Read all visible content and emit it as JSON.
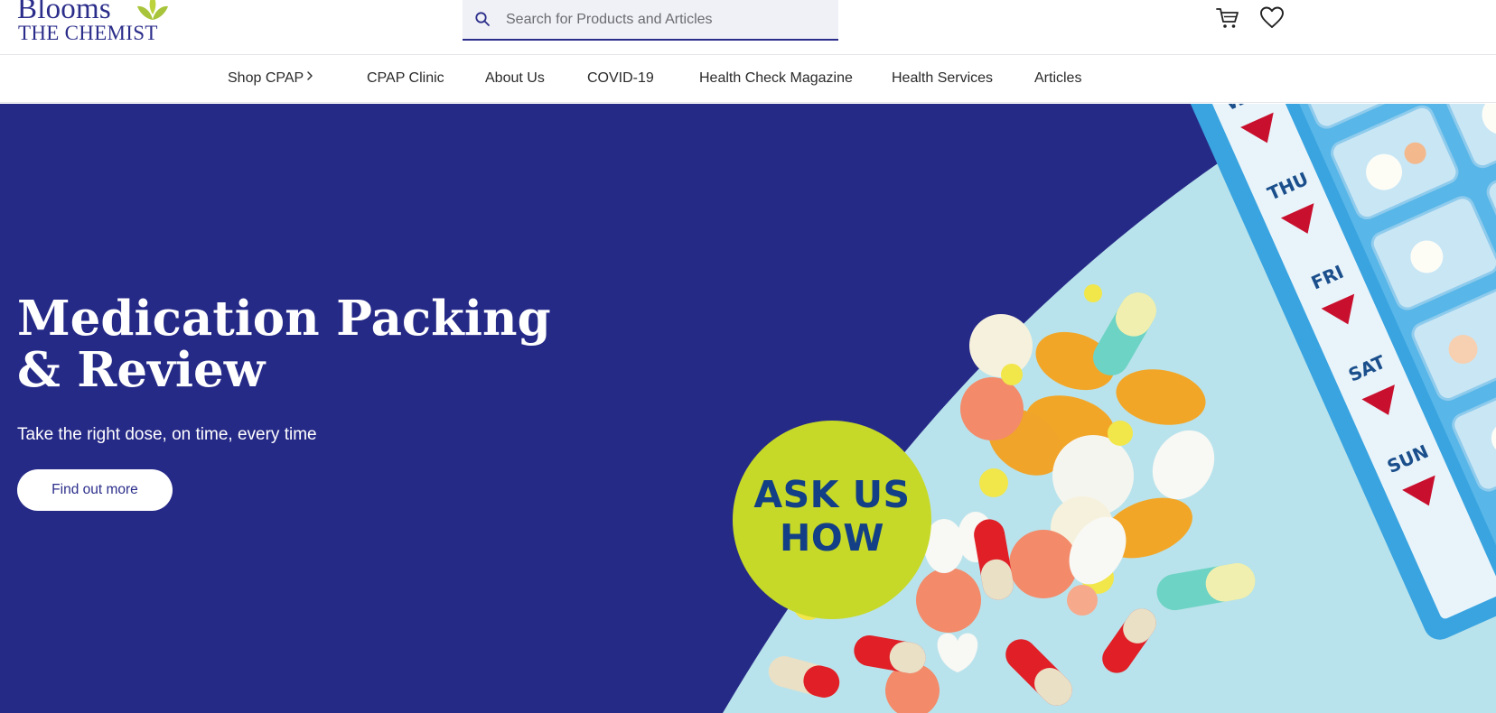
{
  "brand": {
    "name_top": "Blooms",
    "name_bottom": "THE CHEMIST",
    "primary_color": "#2b2d8a",
    "accent_color": "#c6d928"
  },
  "search": {
    "placeholder": "Search for Products and Articles",
    "value": ""
  },
  "header_icons": {
    "cart": "cart-icon",
    "wishlist": "heart-icon"
  },
  "nav": {
    "items": [
      {
        "label": "Shop CPAP",
        "has_chevron": true
      },
      {
        "label": "CPAP Clinic"
      },
      {
        "label": "About Us"
      },
      {
        "label": "COVID-19"
      },
      {
        "label": "Health Check Magazine"
      },
      {
        "label": "Health Services"
      },
      {
        "label": "Articles"
      }
    ]
  },
  "hero": {
    "background_color": "#262a87",
    "title": "Medication Packing & Review",
    "subtitle": "Take the right dose, on time, every time",
    "button_label": "Find out more",
    "badge_text_line1": "ASK US",
    "badge_text_line2": "HOW",
    "pill_box_days": [
      "WED",
      "THU",
      "FRI",
      "SAT",
      "SUN"
    ]
  }
}
